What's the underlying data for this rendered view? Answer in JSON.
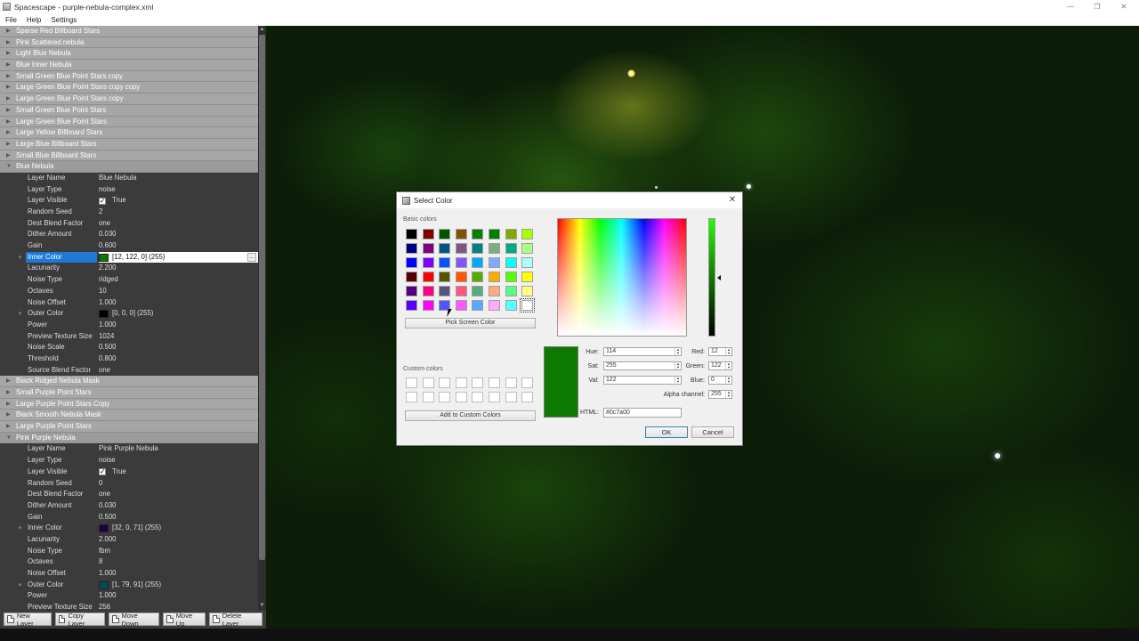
{
  "window": {
    "title": "Spacescape - purple-nebula-complex.xml",
    "minimize_icon": "minimize-icon",
    "restore_icon": "restore-icon",
    "close_icon": "close-icon"
  },
  "menu": [
    "File",
    "Help",
    "Settings"
  ],
  "layers_top": [
    "Sparse Red Billboard Stars",
    "Pink Scattered nebula",
    "Light Blue Nebula",
    "Blue Inner Nebula",
    "Small Green Blue Point Stars copy",
    "Large Green Blue Point Stars copy copy",
    "Large Green Blue Point Stars copy",
    "Small Green Blue Point Stars",
    "Large Green Blue Point Stars",
    "Large Yellow Billboard Stars",
    "Large Blue Billboard Stars",
    "Small Blue Billboard Stars"
  ],
  "blue_nebula": {
    "header": "Blue Nebula",
    "props": [
      {
        "name": "Layer Name",
        "value": "Blue Nebula"
      },
      {
        "name": "Layer Type",
        "value": "noise"
      },
      {
        "name": "Layer Visible",
        "value": "True",
        "check": true
      },
      {
        "name": "Random Seed",
        "value": "2"
      },
      {
        "name": "Dest Blend Factor",
        "value": "one"
      },
      {
        "name": "Dither Amount",
        "value": "0.030"
      },
      {
        "name": "Gain",
        "value": "0.600"
      },
      {
        "name": "Inner Color",
        "value": "[12, 122, 0] (255)",
        "swatch": "#0c7a00",
        "selected": true
      },
      {
        "name": "Lacunarity",
        "value": "2.200"
      },
      {
        "name": "Noise Type",
        "value": "ridged"
      },
      {
        "name": "Octaves",
        "value": "10"
      },
      {
        "name": "Noise Offset",
        "value": "1.000"
      },
      {
        "name": "Outer Color",
        "value": "[0, 0, 0] (255)",
        "swatch": "#000000"
      },
      {
        "name": "Power",
        "value": "1.000"
      },
      {
        "name": "Preview Texture Size",
        "value": "1024"
      },
      {
        "name": "Noise Scale",
        "value": "0.500"
      },
      {
        "name": "Threshold",
        "value": "0.800"
      },
      {
        "name": "Source Blend Factor",
        "value": "one"
      }
    ]
  },
  "layers_mid": [
    "Black Ridged Nebula Mask",
    "Small Purple Point Stars",
    "Large Purple Point Stars Copy",
    "Black Smooth Nebula Mask",
    "Large Purple Point Stars"
  ],
  "pink_purple_nebula": {
    "header": "Pink Purple Nebula",
    "props": [
      {
        "name": "Layer Name",
        "value": "Pink Purple Nebula"
      },
      {
        "name": "Layer Type",
        "value": "noise"
      },
      {
        "name": "Layer Visible",
        "value": "True",
        "check": true
      },
      {
        "name": "Random Seed",
        "value": "0"
      },
      {
        "name": "Dest Blend Factor",
        "value": "one"
      },
      {
        "name": "Dither Amount",
        "value": "0.030"
      },
      {
        "name": "Gain",
        "value": "0.500"
      },
      {
        "name": "Inner Color",
        "value": "[32, 0, 71] (255)",
        "swatch": "#200047"
      },
      {
        "name": "Lacunarity",
        "value": "2.000"
      },
      {
        "name": "Noise Type",
        "value": "fbm"
      },
      {
        "name": "Octaves",
        "value": "8"
      },
      {
        "name": "Noise Offset",
        "value": "1.000"
      },
      {
        "name": "Outer Color",
        "value": "[1, 79, 91] (255)",
        "swatch": "#014f5b"
      },
      {
        "name": "Power",
        "value": "1.000"
      },
      {
        "name": "Preview Texture Size",
        "value": "256"
      }
    ]
  },
  "toolbar": [
    "New Layer",
    "Copy Layer",
    "Move Down",
    "Move Up",
    "Delete Layer"
  ],
  "dialog": {
    "title": "Select Color",
    "basic_colors_label": "Basic colors",
    "basic_colors": [
      "#000000",
      "#800000",
      "#005500",
      "#805500",
      "#008000",
      "#008000",
      "#80aa00",
      "#aaff00",
      "#000080",
      "#800080",
      "#005580",
      "#805580",
      "#008080",
      "#80aa80",
      "#00aa80",
      "#aaff80",
      "#0000ff",
      "#8000ff",
      "#0055ff",
      "#8055ff",
      "#00aaff",
      "#80aaff",
      "#00ffff",
      "#aaffff",
      "#550000",
      "#ff0000",
      "#555500",
      "#ff5500",
      "#55aa00",
      "#ffaa00",
      "#55ff00",
      "#ffff00",
      "#550080",
      "#ff0080",
      "#555580",
      "#ff5580",
      "#55aa80",
      "#ffaa80",
      "#55ff80",
      "#ffff80",
      "#5500ff",
      "#ff00ff",
      "#5555ff",
      "#ff55ff",
      "#55aaff",
      "#ffaaff",
      "#55ffff",
      "#ffffff"
    ],
    "pick_screen_label": "Pick Screen Color",
    "custom_colors_label": "Custom colors",
    "add_custom_label": "Add to Custom Colors",
    "hue_label": "Hue:",
    "hue": "114",
    "sat_label": "Sat:",
    "sat": "255",
    "val_label": "Val:",
    "val": "122",
    "red_label": "Red:",
    "red": "12",
    "green_label": "Green:",
    "green": "122",
    "blue_label": "Blue:",
    "blue": "0",
    "alpha_label": "Alpha channel:",
    "alpha": "255",
    "html_label": "HTML:",
    "html": "#0c7a00",
    "ok_label": "OK",
    "cancel_label": "Cancel",
    "current_color": "#0c7a00"
  }
}
